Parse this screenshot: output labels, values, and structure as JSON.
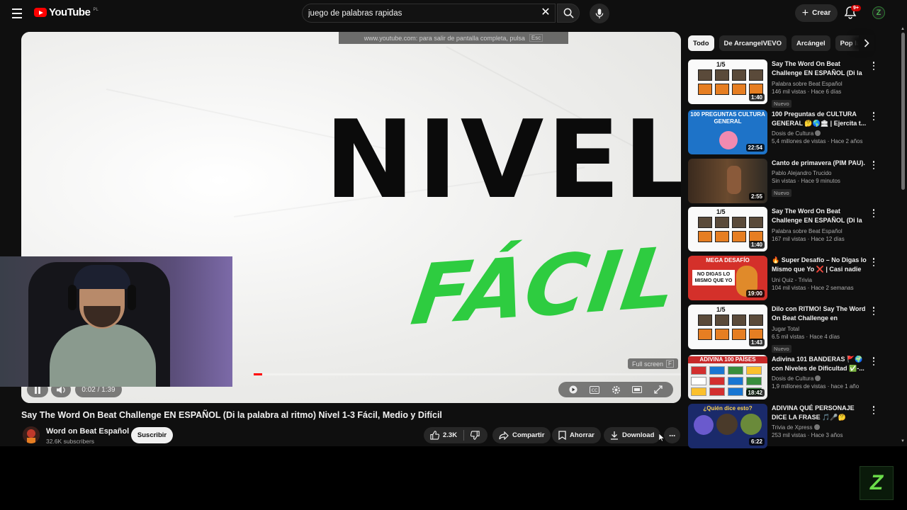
{
  "header": {
    "logo_text": "YouTube",
    "logo_country": "PL",
    "search_value": "juego de palabras rapidas",
    "create_label": "Crear",
    "notification_count": "9+",
    "avatar_letter": "Z"
  },
  "player": {
    "fullscreen_notice": "www.youtube.com: para salir de pantalla completa, pulsa",
    "fullscreen_notice_key": "Esc",
    "overlay_line1": "NIVEL",
    "overlay_line2": "FÁCIL",
    "fullscreen_tip": "Full screen",
    "fullscreen_tip_key": "F",
    "time": "0:02 / 1:39",
    "progress": 0.02
  },
  "video": {
    "title": "Say The Word On Beat Challenge EN ESPAÑOL (Di la palabra al ritmo) Nivel 1-3 Fácil, Medio y Difícil",
    "channel_name": "Word on Beat Español",
    "channel_subs": "32.6K subscribers",
    "subscribe_label": "Suscribir",
    "likes": "2.3K",
    "share_label": "Compartir",
    "save_label": "Ahorrar",
    "download_label": "Download"
  },
  "chips": [
    "Todo",
    "De ArcangelVEVO",
    "Arcángel",
    "Pop la"
  ],
  "recommendations": [
    {
      "title": "Say The Word On Beat Challenge EN ESPAÑOL (Di la ...",
      "channel": "Palabra sobre Beat Español",
      "meta": "146 mil vistas · Hace 6 días",
      "duration": "1:40",
      "badge": "Nuevo",
      "thumb": "grid"
    },
    {
      "title": "100 Preguntas de CULTURA GENERAL 🤔🌎🏛 | Ejercita t...",
      "channel": "Dosis de Cultura",
      "verified": true,
      "meta": "5,4 millones de vistas · Hace 2 años",
      "duration": "22:54",
      "badge": "",
      "thumb": "quiz",
      "thumb_text": "100 PREGUNTAS CULTURA GENERAL"
    },
    {
      "title": "Canto de primavera (PIM PAU).",
      "channel": "Pablo Alejandro Trucido",
      "meta": "Sin vistas · Hace 9 minutos",
      "duration": "2:55",
      "badge": "Nuevo",
      "thumb": "photo"
    },
    {
      "title": "Say The Word On Beat Challenge EN ESPAÑOL (Di la ...",
      "channel": "Palabra sobre Beat Español",
      "meta": "167 mil vistas · Hace 12 días",
      "duration": "1:40",
      "badge": "",
      "thumb": "grid"
    },
    {
      "title": "🔥 Super Desafío – No Digas lo Mismo que Yo ❌ | Casi nadie ...",
      "channel": "Uni Quiz - Trivia",
      "meta": "104 mil vistas · Hace 2 semanas",
      "duration": "19:00",
      "badge": "",
      "thumb": "mega",
      "thumb_text": "MEGA DESAFÍO",
      "thumb_text2": "NO DIGAS LO MISMO QUE YO"
    },
    {
      "title": "Dilo con RITMO! Say The Word On Beat Challenge en ESPAÑO...",
      "channel": "Jugar Total",
      "meta": "6.5 mil vistas · Hace 4 días",
      "duration": "1:43",
      "badge": "Nuevo",
      "thumb": "grid"
    },
    {
      "title": "Adivina 101 BANDERAS 🚩🌍 con Niveles de Dificultad ✅-...",
      "channel": "Dosis de Cultura",
      "verified": true,
      "meta": "1,9 millones de vistas · hace 1 año",
      "duration": "18:42",
      "badge": "",
      "thumb": "flags",
      "thumb_text": "ADIVINA 100 PAÍSES"
    },
    {
      "title": "ADIVINA QUÉ PERSONAJE DICE LA FRASE 🎵🎤🤔",
      "channel": "Trivia de Xpress",
      "verified": true,
      "meta": "253 mil vistas · Hace 3 años",
      "duration": "6:22",
      "badge": "",
      "thumb": "who",
      "thumb_text": "¿Quién dice esto?"
    }
  ],
  "colors": {
    "accent": "#ff0000",
    "bg": "#0f0f0f",
    "green": "#2ecc40"
  }
}
